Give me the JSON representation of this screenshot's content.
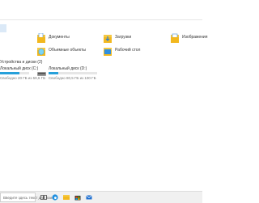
{
  "address_bar": {
    "value": ""
  },
  "folders": [
    {
      "label": "Документы",
      "color": "#f5c842",
      "accent": "#4a8fd8"
    },
    {
      "label": "Загрузки",
      "color": "#f5c842",
      "accent": "#2a7fd6"
    },
    {
      "label": "Изображения",
      "color": "#f5c842",
      "accent": "#4a8fd8"
    },
    {
      "label": "Объемные объекты",
      "color": "#7bd4f5",
      "accent": "#3aa0e0"
    },
    {
      "label": "Рабочий стол",
      "color": "#2f8fe0",
      "accent": "#6bb8f0"
    }
  ],
  "devices": {
    "header": "Устройства и диски (2)",
    "drives": [
      {
        "name": "Локальный диск (C:)",
        "sub": "Свободно 20 ГБ из 59,6 ГБ",
        "fill": 0.66
      },
      {
        "name": "Локальный диск (D:)",
        "sub": "Свободно 80,5 ГБ из 100 ГБ",
        "fill": 0.2
      }
    ]
  },
  "taskbar": {
    "search_placeholder": "Введите здесь текст для поиска",
    "icons": [
      "task-view-icon",
      "edge-icon",
      "file-explorer-icon",
      "store-icon",
      "mail-icon"
    ]
  },
  "colors": {
    "accent": "#26a0da",
    "folder": "#f5c842"
  }
}
